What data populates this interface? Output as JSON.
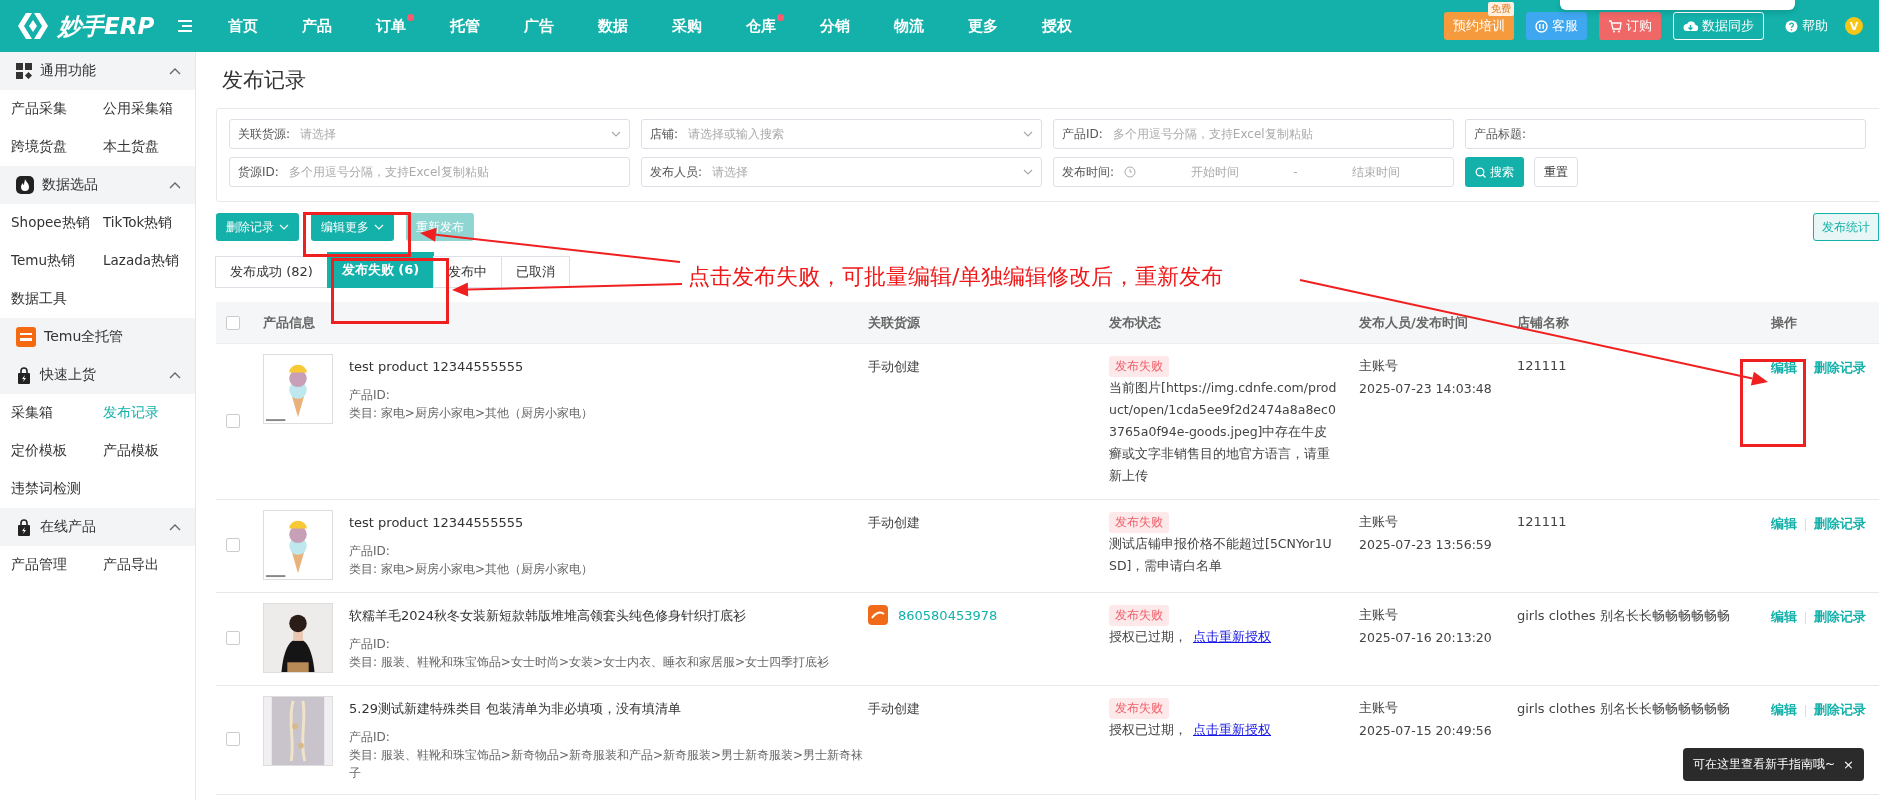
{
  "topbar": {
    "logo": "妙手ERP",
    "nav": [
      {
        "label": "首页",
        "dot": false
      },
      {
        "label": "产品",
        "dot": false
      },
      {
        "label": "订单",
        "dot": true
      },
      {
        "label": "托管",
        "dot": false
      },
      {
        "label": "广告",
        "dot": false
      },
      {
        "label": "数据",
        "dot": false
      },
      {
        "label": "采购",
        "dot": false
      },
      {
        "label": "仓库",
        "dot": true
      },
      {
        "label": "分销",
        "dot": false
      },
      {
        "label": "物流",
        "dot": false
      },
      {
        "label": "更多",
        "dot": false
      },
      {
        "label": "授权",
        "dot": false
      }
    ],
    "actions": [
      {
        "kind": "training",
        "label": "预约培训",
        "badge": "免费"
      },
      {
        "kind": "service",
        "label": "客服"
      },
      {
        "kind": "order",
        "label": "订购"
      },
      {
        "kind": "sync",
        "label": "数据同步"
      },
      {
        "kind": "help",
        "label": "帮助"
      }
    ],
    "avatar": "V"
  },
  "sidebar": {
    "sections": [
      {
        "title": "通用功能",
        "expanded": true,
        "items": [
          {
            "label": "产品采集",
            "selected": false
          },
          {
            "label": "公用采集箱",
            "selected": false
          },
          {
            "label": "跨境货盘",
            "selected": false
          },
          {
            "label": "本土货盘",
            "selected": false
          }
        ]
      },
      {
        "title": "数据选品",
        "expanded": true,
        "items": [
          {
            "label": "Shopee热销",
            "selected": false
          },
          {
            "label": "TikTok热销",
            "selected": false
          },
          {
            "label": "Temu热销",
            "selected": false
          },
          {
            "label": "Lazada热销",
            "selected": false
          },
          {
            "label": "数据工具",
            "selected": false
          }
        ]
      },
      {
        "title": "Temu全托管"
      },
      {
        "title": "快速上货",
        "expanded": true,
        "items": [
          {
            "label": "采集箱",
            "selected": false
          },
          {
            "label": "发布记录",
            "selected": true
          },
          {
            "label": "定价模板",
            "selected": false
          },
          {
            "label": "产品模板",
            "selected": false
          },
          {
            "label": "违禁词检测",
            "selected": false
          }
        ]
      },
      {
        "title": "在线产品",
        "expanded": true,
        "items": [
          {
            "label": "产品管理",
            "selected": false
          },
          {
            "label": "产品导出",
            "selected": false
          }
        ]
      }
    ]
  },
  "page_title": "发布记录",
  "filters": [
    {
      "kind": "select",
      "label": "关联货源:",
      "placeholder": "请选择"
    },
    {
      "kind": "select",
      "label": "店铺:",
      "placeholder": "请选择或输入搜索"
    },
    {
      "kind": "input",
      "label": "产品ID:",
      "placeholder": "多个用逗号分隔，支持Excel复制粘贴"
    },
    {
      "kind": "input",
      "label": "产品标题:"
    },
    {
      "kind": "input",
      "label": "货源ID:",
      "placeholder": "多个用逗号分隔，支持Excel复制粘贴"
    },
    {
      "kind": "select",
      "label": "发布人员:",
      "placeholder": "请选择"
    },
    {
      "kind": "daterange",
      "label": "发布时间:",
      "start_placeholder": "开始时间",
      "separator": "-",
      "end_placeholder": "结束时间"
    }
  ],
  "filter_buttons": {
    "search": "搜索",
    "reset": "重置"
  },
  "toolbar": [
    {
      "label": "删除记录",
      "dropdown": true,
      "disabled": false
    },
    {
      "label": "编辑更多",
      "dropdown": true,
      "disabled": false
    },
    {
      "label": "重新发布",
      "dropdown": false,
      "disabled": true
    }
  ],
  "stats_button": "发布统计",
  "tabs": [
    {
      "label": "发布成功 (82)",
      "selected": false
    },
    {
      "label": "发布失败 (6)",
      "selected": true
    },
    {
      "label": "发布中",
      "selected": false
    },
    {
      "label": "已取消",
      "selected": false
    }
  ],
  "table": {
    "header_checked": false,
    "columns": [
      "产品信息",
      "关联货源",
      "发布状态",
      "发布人员/发布时间",
      "店铺名称",
      "操作"
    ],
    "rows": [
      {
        "checked": false,
        "title": "test product 12344555555",
        "product_id": "产品ID:",
        "category": "类目: 家电>厨房小家电>其他（厨房小家电）",
        "source": {
          "kind": "manual",
          "text": "手动创建"
        },
        "status": "发布失败",
        "message": "当前图片[https://img.cdnfe.com/product/open/1cda5ee9f2d2474a8a8ec03765a0f94e-goods.jpeg]中存在牛皮癣或文字非销售目的地官方语言，请重新上传",
        "publisher": "主账号",
        "time": "2025-07-23 14:03:48",
        "store": "121111",
        "actions": [
          "编辑",
          "删除记录"
        ]
      },
      {
        "checked": false,
        "title": "test product 12344555555",
        "product_id": "产品ID:",
        "category": "类目: 家电>厨房小家电>其他（厨房小家电）",
        "source": {
          "kind": "manual",
          "text": "手动创建"
        },
        "status": "发布失败",
        "message": "测试店铺申报价格不能超过[5CNYor1USD]，需申请白名单",
        "publisher": "主账号",
        "time": "2025-07-23 13:56:59",
        "store": "121111",
        "actions": [
          "编辑",
          "删除记录"
        ]
      },
      {
        "checked": false,
        "title": "软糯羊毛2024秋冬女装新短款韩版堆堆高领套头纯色修身针织打底衫",
        "product_id": "产品ID:",
        "category": "类目: 服装、鞋靴和珠宝饰品>女士时尚>女装>女士内衣、睡衣和家居服>女士四季打底衫",
        "source": {
          "kind": "link",
          "text": "860580453978"
        },
        "status": "发布失败",
        "message": "授权已过期，",
        "link": "点击重新授权",
        "publisher": "主账号",
        "time": "2025-07-16 20:13:20",
        "store": "girls clothes 别名长长畅畅畅畅畅畅",
        "actions": [
          "编辑",
          "删除记录"
        ]
      },
      {
        "checked": false,
        "title": "5.29测试新建特殊类目 包装清单为非必填项，没有填清单",
        "product_id": "产品ID:",
        "category": "类目: 服装、鞋靴和珠宝饰品>新奇物品>新奇服装和产品>新奇服装>男士新奇服装>男士新奇袜子",
        "source": {
          "kind": "manual",
          "text": "手动创建"
        },
        "status": "发布失败",
        "message": "授权已过期，",
        "link": "点击重新授权",
        "publisher": "主账号",
        "time": "2025-07-15 20:49:56",
        "store": "girls clothes 别名长长畅畅畅畅畅畅",
        "actions": [
          "编辑",
          "删除记录"
        ]
      }
    ]
  },
  "annotation": {
    "text": "点击发布失败，可批量编辑/单独编辑修改后，重新发布"
  },
  "tooltip": {
    "text": "可在这里查看新手指南哦~",
    "close": "×"
  }
}
